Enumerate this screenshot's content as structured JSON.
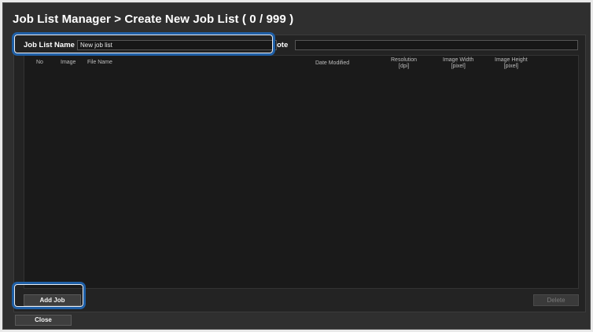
{
  "window": {
    "title": "Job List Manager > Create New Job List ( 0 / 999 )"
  },
  "form": {
    "job_list_name_label": "Job List Name",
    "job_list_name_value": "New job list",
    "note_label": "ote",
    "note_value": ""
  },
  "table": {
    "columns": [
      {
        "label": "No"
      },
      {
        "label": "Image"
      },
      {
        "label": "File Name"
      },
      {
        "label": "Date Modified"
      },
      {
        "label": "Resolution\n[dpi]"
      },
      {
        "label": "Image Width\n[pixel]"
      },
      {
        "label": "Image Height\n[pixel]"
      }
    ],
    "rows": []
  },
  "buttons": {
    "add_job": "Add Job",
    "delete": "Delete",
    "close": "Close"
  },
  "colors": {
    "highlight": "#1f5fa6",
    "window_bg": "#2f2f2f",
    "table_bg": "#1a1a1a"
  }
}
